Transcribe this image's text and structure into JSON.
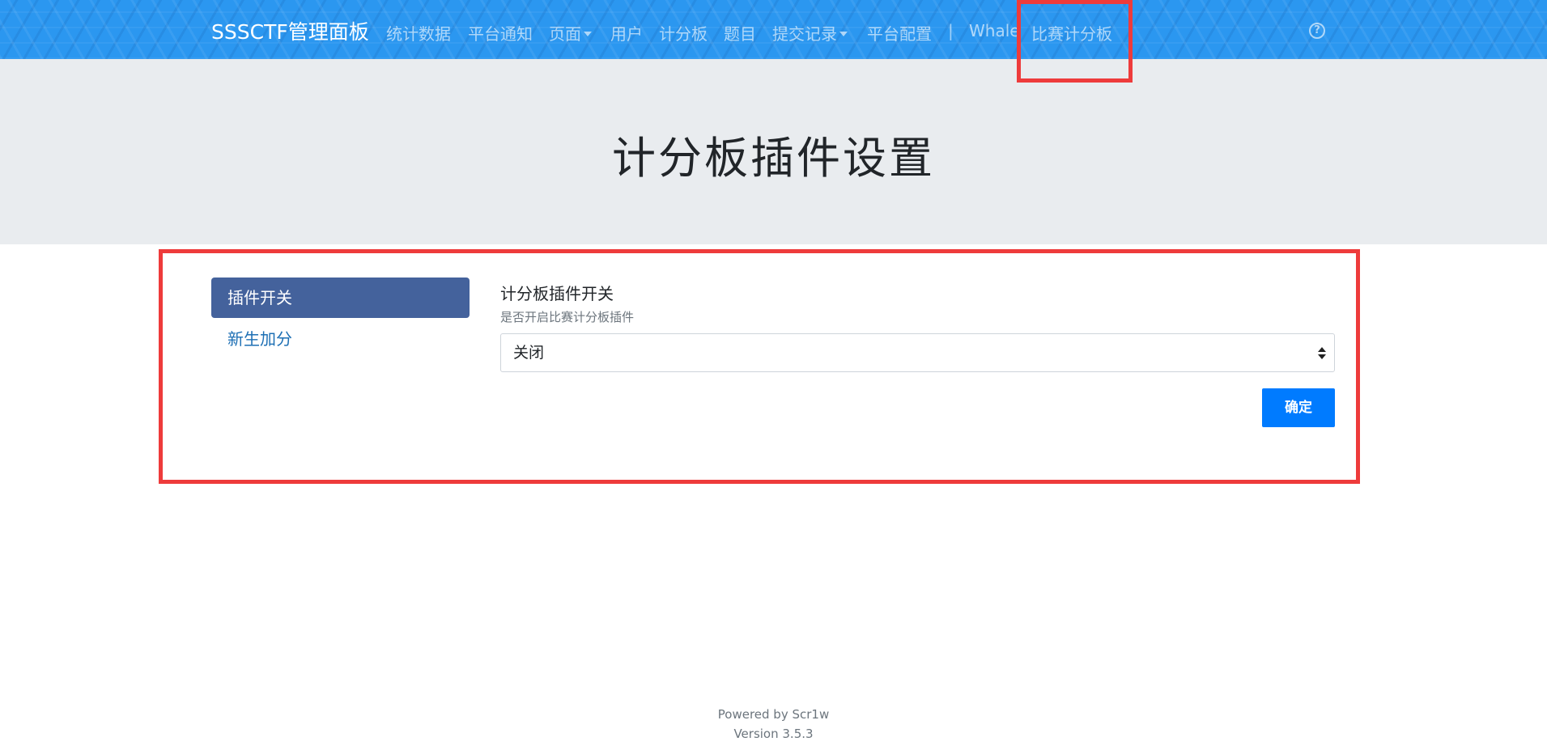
{
  "navbar": {
    "brand": "SSSCTF管理面板",
    "items": [
      {
        "label": "统计数据"
      },
      {
        "label": "平台通知"
      },
      {
        "label": "页面"
      },
      {
        "label": "用户"
      },
      {
        "label": "计分板"
      },
      {
        "label": "题目"
      },
      {
        "label": "提交记录"
      },
      {
        "label": "平台配置"
      },
      {
        "label": "Whale"
      },
      {
        "label": "比赛计分板"
      }
    ],
    "separator": "|",
    "help_icon": "question-circle-icon"
  },
  "page": {
    "title": "计分板插件设置"
  },
  "sidebar": {
    "items": [
      {
        "label": "插件开关",
        "active": true
      },
      {
        "label": "新生加分",
        "active": false
      }
    ]
  },
  "form": {
    "label": "计分板插件开关",
    "help": "是否开启比赛计分板插件",
    "select_value": "关闭",
    "submit_label": "确定"
  },
  "footer": {
    "line1": "Powered by Scr1w",
    "line2": "Version 3.5.3"
  },
  "colors": {
    "navbar_bg": "#2b97f0",
    "jumbotron_bg": "#e9ecef",
    "sidebar_active": "#44629c",
    "link": "#1d6fb4",
    "primary_button": "#007bff",
    "highlight": "#ee3b3b"
  }
}
